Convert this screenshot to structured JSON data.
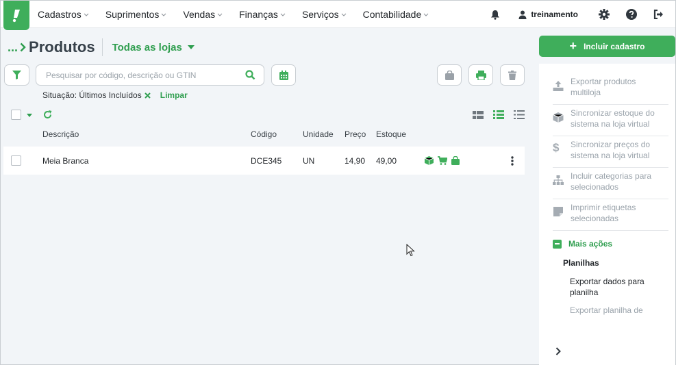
{
  "nav": {
    "items": [
      {
        "label": "Cadastros"
      },
      {
        "label": "Suprimentos"
      },
      {
        "label": "Vendas"
      },
      {
        "label": "Finanças"
      },
      {
        "label": "Serviços"
      },
      {
        "label": "Contabilidade"
      }
    ],
    "user_name": "treinamento"
  },
  "header": {
    "breadcrumb_dots": "...",
    "title": "Produtos",
    "store_selector": "Todas as lojas"
  },
  "search": {
    "placeholder": "Pesquisar por código, descrição ou GTIN",
    "value": ""
  },
  "filter": {
    "situation": "Situação: Últimos Incluídos",
    "clear_label": "Limpar"
  },
  "table": {
    "columns": {
      "description": "Descrição",
      "code": "Código",
      "unit": "Unidade",
      "price": "Preço",
      "stock": "Estoque"
    },
    "rows": [
      {
        "description": "Meia Branca",
        "code": "DCE345",
        "unit": "UN",
        "price": "14,90",
        "stock": "49,00"
      }
    ]
  },
  "sidebar": {
    "include_button": "Incluir cadastro",
    "actions": [
      {
        "label": "Exportar produtos multiloja",
        "icon": "upload-icon"
      },
      {
        "label": "Sincronizar estoque do sistema na loja virtual",
        "icon": "box-icon"
      },
      {
        "label": "Sincronizar preços do sistema na loja virtual",
        "icon": "dollar-icon"
      },
      {
        "label": "Incluir categorias para selecionados",
        "icon": "sitemap-icon"
      },
      {
        "label": "Imprimir etiquetas selecionadas",
        "icon": "sticky-note-icon"
      }
    ],
    "more_actions": "Mais ações",
    "sheets_title": "Planilhas",
    "sheet_items": [
      {
        "label": "Exportar dados para planilha"
      },
      {
        "label": "Exportar planilha de"
      }
    ]
  },
  "colors": {
    "brand_green": "#3fae5b",
    "text_green": "#2f9e4f",
    "background": "#f2f5f8"
  }
}
